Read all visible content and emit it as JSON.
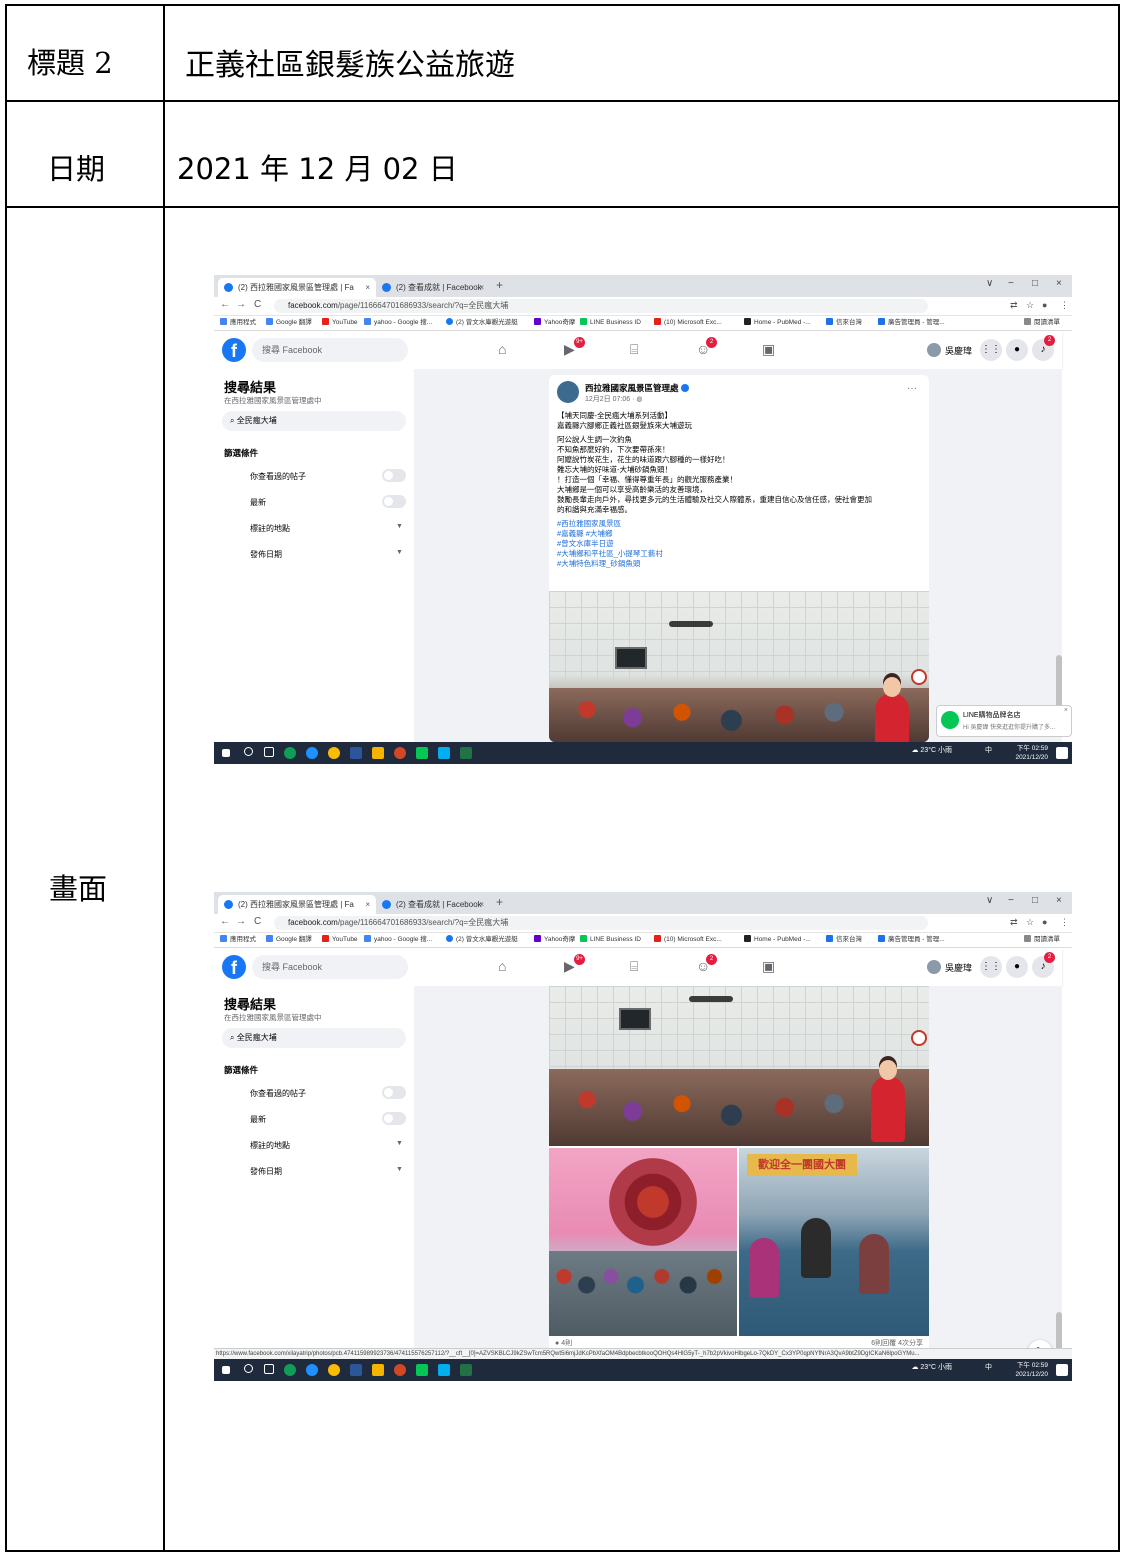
{
  "row_title": {
    "label": "標題 2",
    "value": "正義社區銀髮族公益旅遊"
  },
  "row_date": {
    "label": "日期",
    "value": "2021 年 12 月 02 日"
  },
  "row_screen": {
    "label": "畫面"
  },
  "screenshot": {
    "tabs": [
      {
        "label": "(2) 西拉雅國家風景區管理處 | Fa",
        "close": "×"
      },
      {
        "label": "(2) 查看成就 | Facebook",
        "close": "×"
      }
    ],
    "new_tab": "+",
    "window_controls": [
      "∨",
      "−",
      "□",
      "×"
    ],
    "url_host": "facebook.com",
    "url_path": "/page/116664701686933/search/?q=全民瘋大埔",
    "bookmarks": [
      "應用程式",
      "Google 翻譯",
      "YouTube",
      "yahoo - Google 搜...",
      "(2) 曾文水庫觀光遊艇",
      "Yahoo奇摩",
      "LINE Business ID",
      "(10) Microsoft Exc...",
      "Home - PubMed -...",
      "信來台灣",
      "廣告管理員 - 管理...",
      "閱讀清單"
    ],
    "fb_search_placeholder": "搜尋 Facebook",
    "badges": {
      "watch": "9+",
      "groups": "2",
      "notifications": "2"
    },
    "user_name": "吳慶瑋",
    "left_panel": {
      "title": "搜尋結果",
      "subtitle": "在西拉雅國家風景區管理處中",
      "query": "全民瘋大埔",
      "filters_heading": "篩選條件",
      "options": [
        "你查看過的帖子",
        "最新",
        "標註的地點",
        "發佈日期"
      ]
    },
    "post": {
      "page_name": "西拉雅國家風景區管理處",
      "time": "12月2日 07:06 · ",
      "lines": [
        "【埔天同慶-全民瘋大埔系列活動】",
        "嘉義縣六腳鄉正義社區銀髮族來大埔遊玩",
        "阿公說人生調一次釣魚",
        "不知魚那麼好釣，下次要帶孫來！",
        "阿嬤說竹炭花生，花生的味道跟六腳種的一樣好吃！",
        "難忘大埔的好味道-大埔砂鍋魚頭！",
        "！打造一個「幸福、懂得尊重年長」的觀光服務產業！",
        "大埔鄉是一個可以享受高齡樂活的友善環境，",
        "鼓勵長輩走向戶外，尋找更多元的生活體驗及社交人際體系，重建自信心及信任感，使社會更加",
        "的和諧與充滿幸福感。"
      ],
      "tags": [
        "#西拉雅國家風景區",
        "#嘉義縣 #大埔鄉",
        "#曾文水庫半日遊",
        "#大埔鄉和平社區_小提琴工藝村",
        "#大埔特色料理_砂鍋魚頭"
      ],
      "lake_sign": "歡迎全一團國大團"
    },
    "line_toast": {
      "title": "LINE購物品牌名店",
      "body": "Hi 吳慶瑋 快來逛逛你提升購了多...",
      "close": "×"
    },
    "post_footer": {
      "left": "4則",
      "right": "6則回覆 4次分享"
    },
    "status_url": "https://www.facebook.com/xilayatrip/photos/pcb.474115989923736/474115576257112/?__cft__[0]=AZVSKBLCJ9kZSwTcm5RQwt5i6mjJdKcPbXfaOM4BdpbecbtkooQOHQs4HlG5yT-_h7b2pVkivoHlbgeLo-7QkDY_Cx3YP0qpNYfNrA3QvA9btZ9DgICKaN6lpoGYMu...",
    "taskbar": {
      "weather": "23°C 小雨",
      "ime": "中",
      "time": "下午 02:59",
      "date": "2021/12/20"
    }
  }
}
